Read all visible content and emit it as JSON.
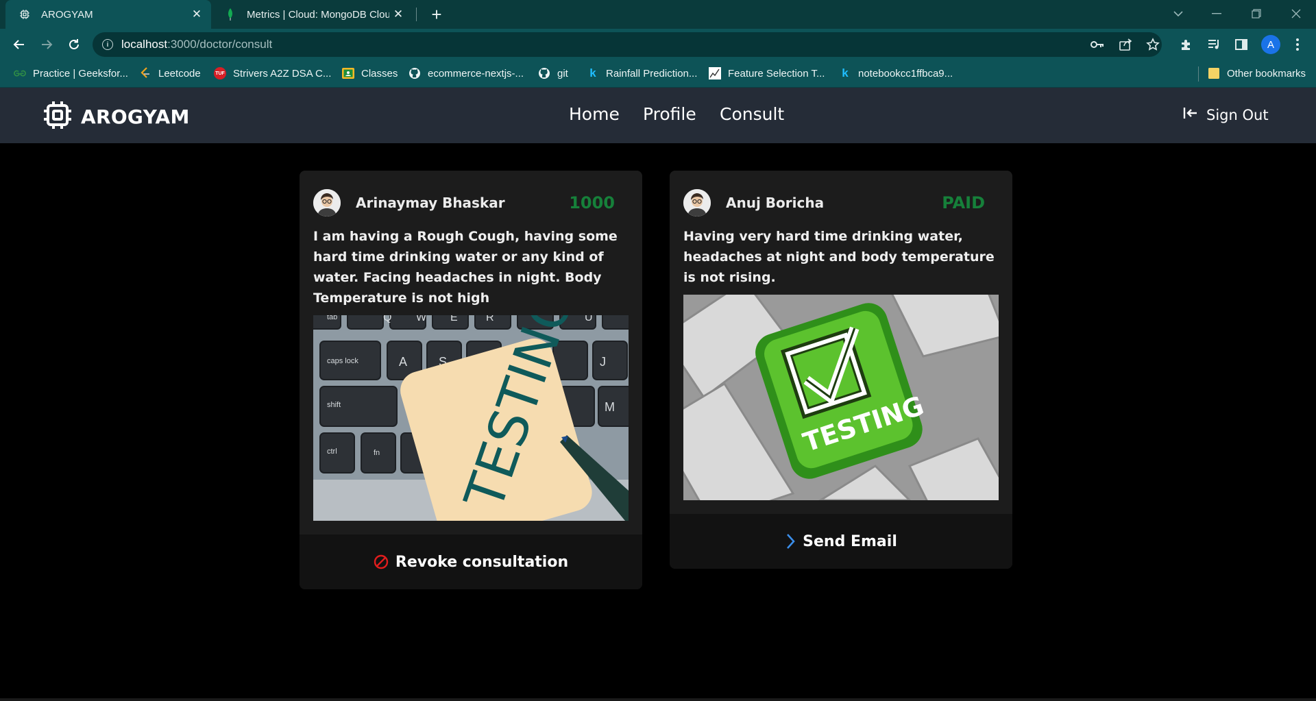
{
  "browser": {
    "tabs": [
      {
        "title": "AROGYAM",
        "active": true
      },
      {
        "title": "Metrics | Cloud: MongoDB Cloud",
        "active": false
      }
    ],
    "url_host": "localhost",
    "url_path": ":3000/doctor/consult",
    "profile_initial": "A",
    "bookmarks": [
      {
        "label": "Practice | Geeksfor...",
        "icon": "gfg-icon"
      },
      {
        "label": "Leetcode",
        "icon": "leetcode-icon"
      },
      {
        "label": "Strivers A2Z DSA C...",
        "icon": "tuf-icon"
      },
      {
        "label": "Classes",
        "icon": "classroom-icon"
      },
      {
        "label": "ecommerce-nextjs-...",
        "icon": "github-icon"
      },
      {
        "label": "git",
        "icon": "github-icon"
      },
      {
        "label": "Rainfall Prediction...",
        "icon": "kaggle-icon"
      },
      {
        "label": "Feature Selection T...",
        "icon": "chart-icon"
      },
      {
        "label": "notebookcc1ffbca9...",
        "icon": "kaggle-icon"
      }
    ],
    "other_bookmarks": "Other bookmarks",
    "colors": {
      "tabbar": "#0a3b3c",
      "toolbar": "#0d5357"
    }
  },
  "app": {
    "brand": "AROGYAM",
    "nav": [
      "Home",
      "Profile",
      "Consult"
    ],
    "signout": "Sign Out",
    "colors": {
      "nav_bg": "#252c37",
      "status_green": "#16803a",
      "revoke_red": "#e11d1d",
      "email_blue": "#3b8eea"
    }
  },
  "consultations": [
    {
      "patient": "Arinaymay Bhaskar",
      "status": "1000",
      "description": "I am having a Rough Cough, having some hard time drinking water or any kind of water. Facing headaches in night. Body Temperature is not high",
      "image": "testing-sticky-note-on-keyboard",
      "action": "Revoke consultation",
      "action_icon": "ban-icon"
    },
    {
      "patient": "Anuj Boricha",
      "status": "PAID",
      "description": "Having very hard time drinking water, headaches at night and body temperature is not rising.",
      "image": "green-testing-key-with-checkmark",
      "action": "Send Email",
      "action_icon": "chevron-right-icon"
    }
  ]
}
